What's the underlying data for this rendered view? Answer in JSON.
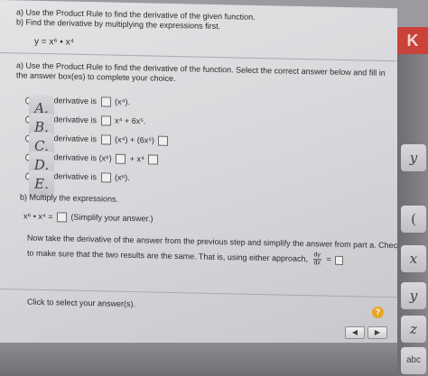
{
  "header": {
    "line_a": "a) Use the Product Rule to find the derivative of the given function.",
    "line_b": "b) Find the derivative by multiplying the expressions first.",
    "equation": "y = x⁶ • x⁴"
  },
  "part_a": {
    "instruction_1": "a) Use the Product Rule to find the derivative of the function. Select the correct answer below and fill in",
    "instruction_2": "the answer box(es) to complete your choice.",
    "options": [
      {
        "key": "A.",
        "prefix": "The derivative is",
        "expr": "(x⁴)."
      },
      {
        "key": "B.",
        "prefix": "The derivative is",
        "expr": "x⁴ + 6x⁵."
      },
      {
        "key": "C.",
        "prefix": "The derivative is",
        "expr_a": "(x⁴) + (6x⁵)"
      },
      {
        "key": "D.",
        "prefix": "The derivative is",
        "expr_a": "(x⁶)",
        "expr_b": "+ x⁴"
      },
      {
        "key": "E.",
        "prefix": "The derivative is",
        "expr": "(x⁶)."
      }
    ]
  },
  "part_b": {
    "title": "b) Multiply the expressions.",
    "expr": "x⁶ • x⁴ =",
    "hint": "(Simplify your answer.)",
    "now_line": "Now take the derivative of the answer from the previous step and simplify the answer from part a. Check",
    "check_line": "to make sure that the two results are the same. That is, using either approach,",
    "frac_num": "dy",
    "frac_den": "dx",
    "equals": "="
  },
  "footer": {
    "click_prompt": "Click to select your answer(s).",
    "help_label": "?",
    "prev_label": "◀",
    "next_label": "▶"
  },
  "side_keys": [
    "y",
    "(",
    "x",
    "y",
    "z",
    "abc"
  ],
  "corner_logo": "K",
  "colors": {
    "help_button": "#e8a623",
    "logo": "#c9433a"
  }
}
